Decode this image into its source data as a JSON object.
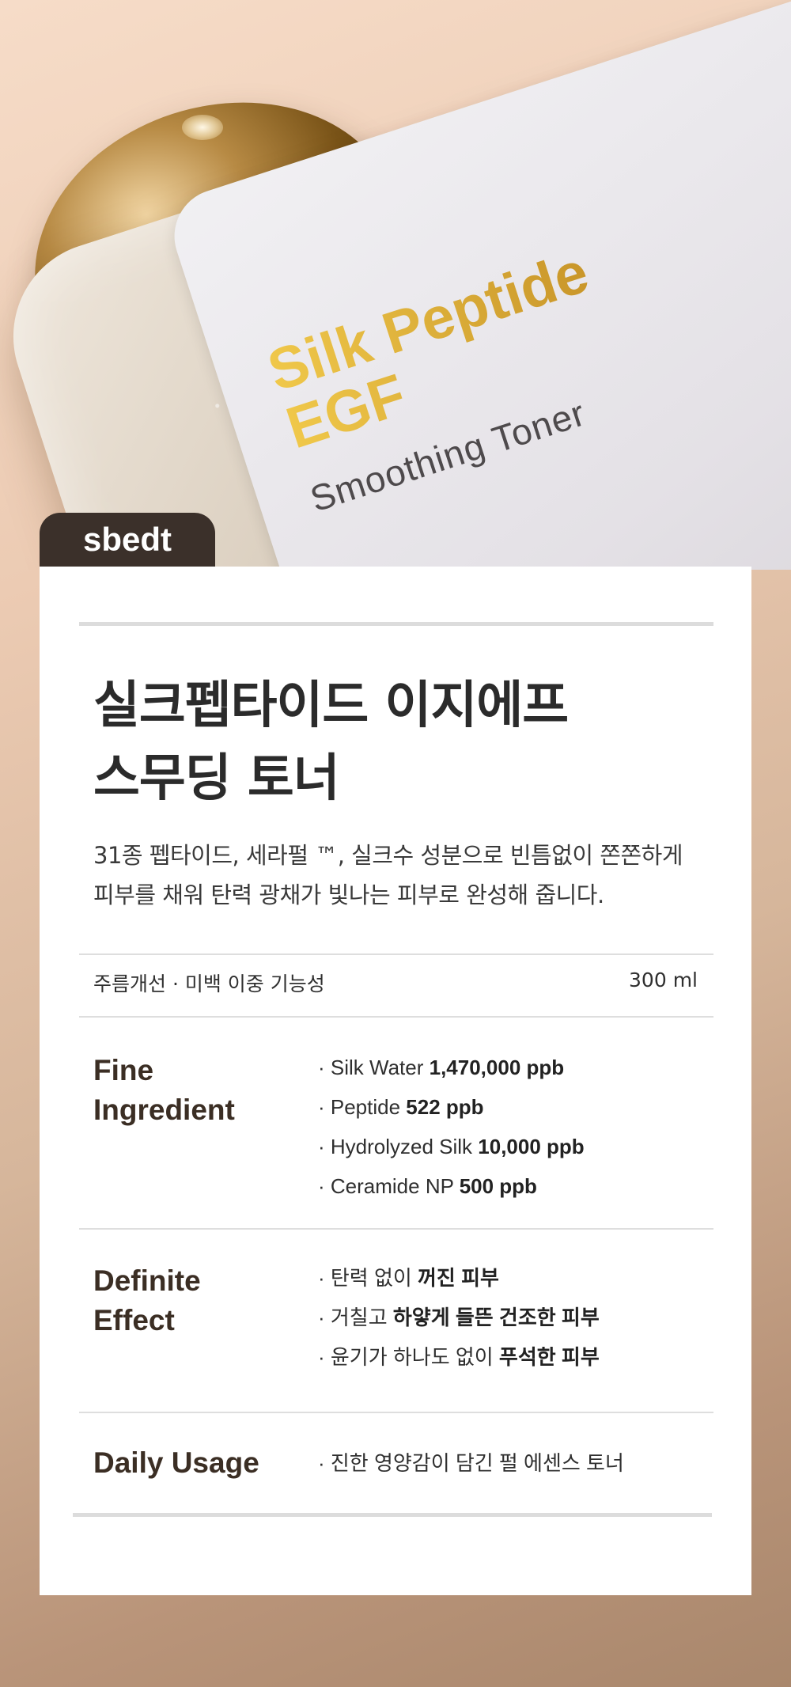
{
  "hero": {
    "label_title": "Silk Peptide\nEGF",
    "label_subtitle": "Smoothing Toner",
    "brand": "sbedt"
  },
  "product": {
    "title_line1": "실크펩타이드 이지에프",
    "title_line2": "스무딩 토너",
    "desc_line1": "31종 펩타이드, 세라펄 ™, 실크수 성분으로 빈틈없이 쫀쫀하게",
    "desc_line2": "피부를 채워 탄력 광채가 빛나는 피부로 완성해 줍니다.",
    "function": "주름개선 · 미백 이중 기능성",
    "volume": "300 ml"
  },
  "sections": {
    "ingredient": {
      "head_line1": "Fine",
      "head_line2": "Ingredient",
      "items": [
        {
          "prefix": "· Silk Water  ",
          "strong": "1,470,000 ppb"
        },
        {
          "prefix": "· Peptide  ",
          "strong": "522 ppb"
        },
        {
          "prefix": "· Hydrolyzed Silk ",
          "strong": "10,000 ppb"
        },
        {
          "prefix": "· Ceramide NP ",
          "strong": "500 ppb"
        }
      ]
    },
    "effect": {
      "head_line1": "Definite",
      "head_line2": "Effect",
      "items": [
        {
          "prefix": "· 탄력 없이 ",
          "strong": "꺼진 피부"
        },
        {
          "prefix": "· 거칠고 ",
          "strong": "하얗게 들뜬 건조한 피부"
        },
        {
          "prefix": "· 윤기가 하나도 없이 ",
          "strong": "푸석한 피부"
        }
      ]
    },
    "usage": {
      "head": "Daily Usage",
      "items": [
        {
          "prefix": "· 진한 영양감이 담긴 펄 에센스 토너",
          "strong": ""
        }
      ]
    }
  },
  "colors": {
    "gold": "#d9ad37",
    "brand_tab": "#3b302a",
    "section_head": "#3b2e24"
  }
}
